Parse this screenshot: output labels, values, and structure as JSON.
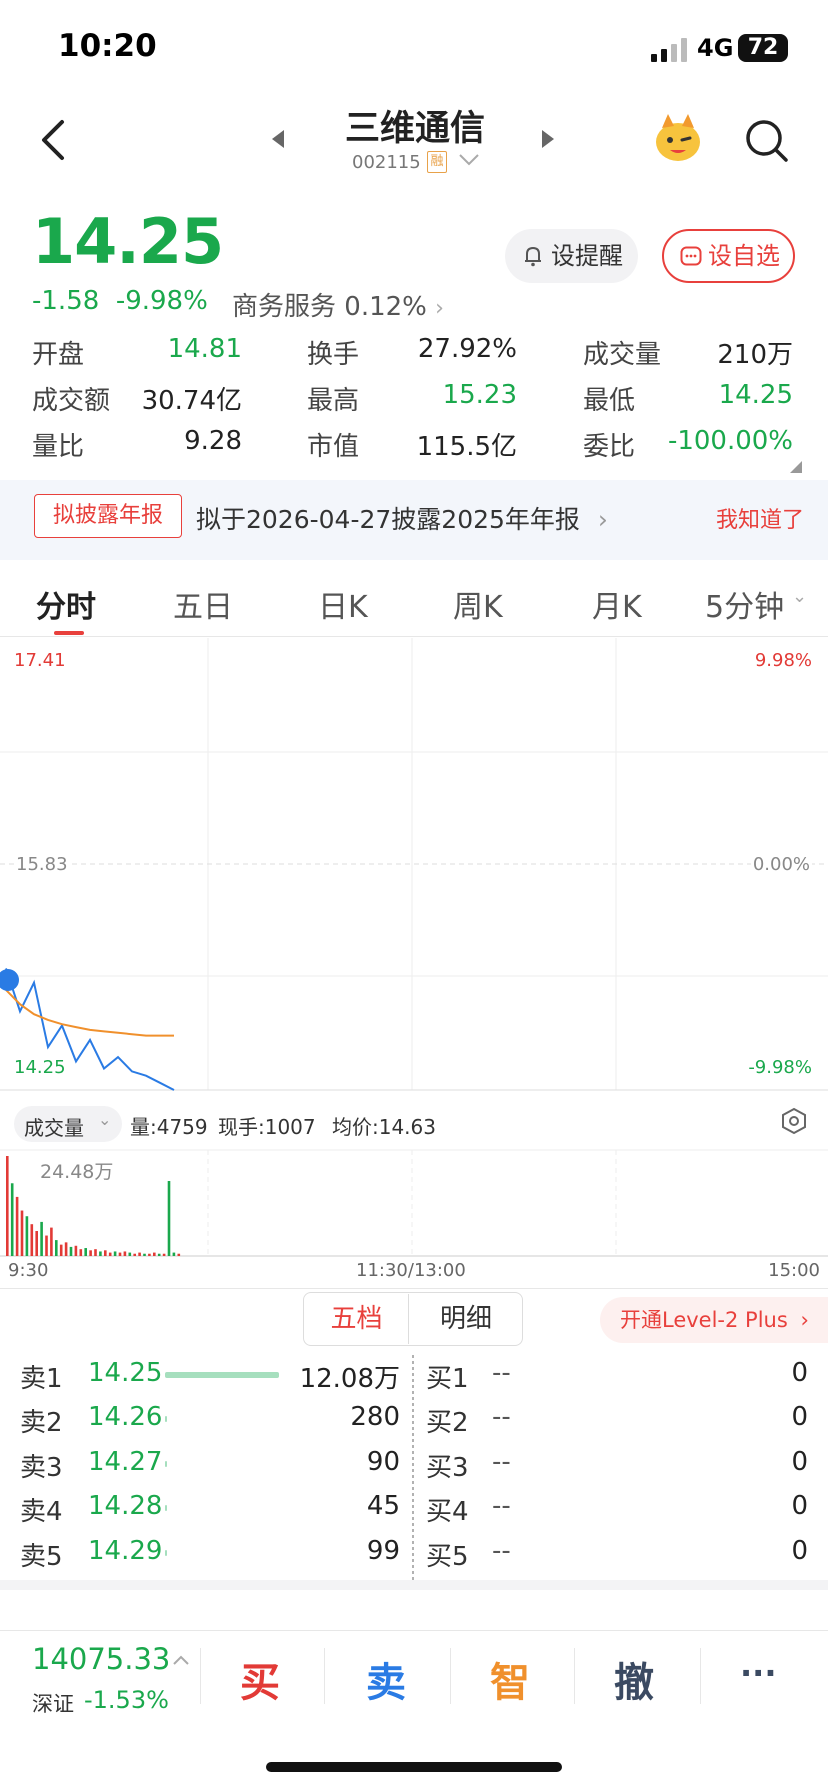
{
  "status": {
    "time": "10:20",
    "network": "4G",
    "battery": "72"
  },
  "header": {
    "title": "三维通信",
    "code": "002115",
    "margin_badge": "融"
  },
  "quote": {
    "price": "14.25",
    "change": "-1.58",
    "change_pct": "-9.98%",
    "sector_name": "商务服务",
    "sector_change": "0.12%",
    "alert_label": "设提醒",
    "watch_label": "设自选"
  },
  "stats": [
    {
      "label": "开盘",
      "value": "14.81",
      "color": "green"
    },
    {
      "label": "换手",
      "value": "27.92%",
      "color": "dark"
    },
    {
      "label": "成交量",
      "value": "210万",
      "color": "dark"
    },
    {
      "label": "成交额",
      "value": "30.74亿",
      "color": "dark"
    },
    {
      "label": "最高",
      "value": "15.23",
      "color": "green"
    },
    {
      "label": "最低",
      "value": "14.25",
      "color": "green"
    },
    {
      "label": "量比",
      "value": "9.28",
      "color": "dark"
    },
    {
      "label": "市值",
      "value": "115.5亿",
      "color": "dark"
    },
    {
      "label": "委比",
      "value": "-100.00%",
      "color": "green"
    }
  ],
  "announcement": {
    "tag": "拟披露年报",
    "text": "拟于2026-04-27披露2025年年报",
    "dismiss": "我知道了"
  },
  "tabs": [
    {
      "label": "分时",
      "active": true
    },
    {
      "label": "五日",
      "active": false
    },
    {
      "label": "日K",
      "active": false
    },
    {
      "label": "周K",
      "active": false
    },
    {
      "label": "月K",
      "active": false
    },
    {
      "label": "5分钟",
      "active": false
    }
  ],
  "chart": {
    "price_high": "17.41",
    "price_mid": "15.83",
    "price_low": "14.25",
    "pct_high": "9.98%",
    "pct_mid": "0.00%",
    "pct_low": "-9.98%",
    "time_start": "9:30",
    "time_mid": "11:30/13:00",
    "time_end": "15:00",
    "volume_selector": "成交量",
    "volume_info": "量:4759",
    "hand_info": "现手:1007",
    "avg_info": "均价:14.63",
    "volume_max": "24.48万",
    "colors": {
      "price_line": "#2a7be4",
      "avg_line": "#f0902c",
      "up": "#e23a36",
      "down": "#1aa84c"
    }
  },
  "chart_data": {
    "type": "line",
    "x_range": [
      "9:30",
      "15:00"
    ],
    "ylim": [
      14.25,
      17.41
    ],
    "series": [
      {
        "values": [
          15.1,
          14.8,
          15.0,
          14.55,
          14.7,
          14.45,
          14.6,
          14.4,
          14.48,
          14.38,
          14.35,
          14.3,
          14.25
        ]
      },
      {
        "values": [
          14.95,
          14.85,
          14.78,
          14.74,
          14.71,
          14.69,
          14.67,
          14.66,
          14.65,
          14.64,
          14.63,
          14.63,
          14.63
        ]
      }
    ],
    "volume": [
      88,
      64,
      52,
      40,
      35,
      28,
      22,
      30,
      18,
      25,
      14,
      10,
      12,
      8,
      9,
      6,
      7,
      5,
      6,
      4,
      5,
      3,
      4,
      3,
      4,
      3,
      2,
      3,
      2,
      2,
      3,
      2,
      2,
      66,
      3,
      2
    ]
  },
  "orderbook": {
    "tab_active": "五档",
    "tab_other": "明细",
    "level2": "开通Level-2 Plus",
    "asks": [
      {
        "label": "卖1",
        "price": "14.25",
        "qty": "12.08万",
        "ratio": 1.0
      },
      {
        "label": "卖2",
        "price": "14.26",
        "qty": "280",
        "ratio": 0.02
      },
      {
        "label": "卖3",
        "price": "14.27",
        "qty": "90",
        "ratio": 0.01
      },
      {
        "label": "卖4",
        "price": "14.28",
        "qty": "45",
        "ratio": 0.01
      },
      {
        "label": "卖5",
        "price": "14.29",
        "qty": "99",
        "ratio": 0.01
      }
    ],
    "bids": [
      {
        "label": "买1",
        "price": "--",
        "qty": "0"
      },
      {
        "label": "买2",
        "price": "--",
        "qty": "0"
      },
      {
        "label": "买3",
        "price": "--",
        "qty": "0"
      },
      {
        "label": "买4",
        "price": "--",
        "qty": "0"
      },
      {
        "label": "买5",
        "price": "--",
        "qty": "0"
      }
    ]
  },
  "bottom": {
    "index_value": "14075.33",
    "index_name": "深证",
    "index_change": "-1.53%",
    "buy": "买",
    "sell": "卖",
    "smart": "智",
    "cancel": "撤",
    "more": "···"
  }
}
